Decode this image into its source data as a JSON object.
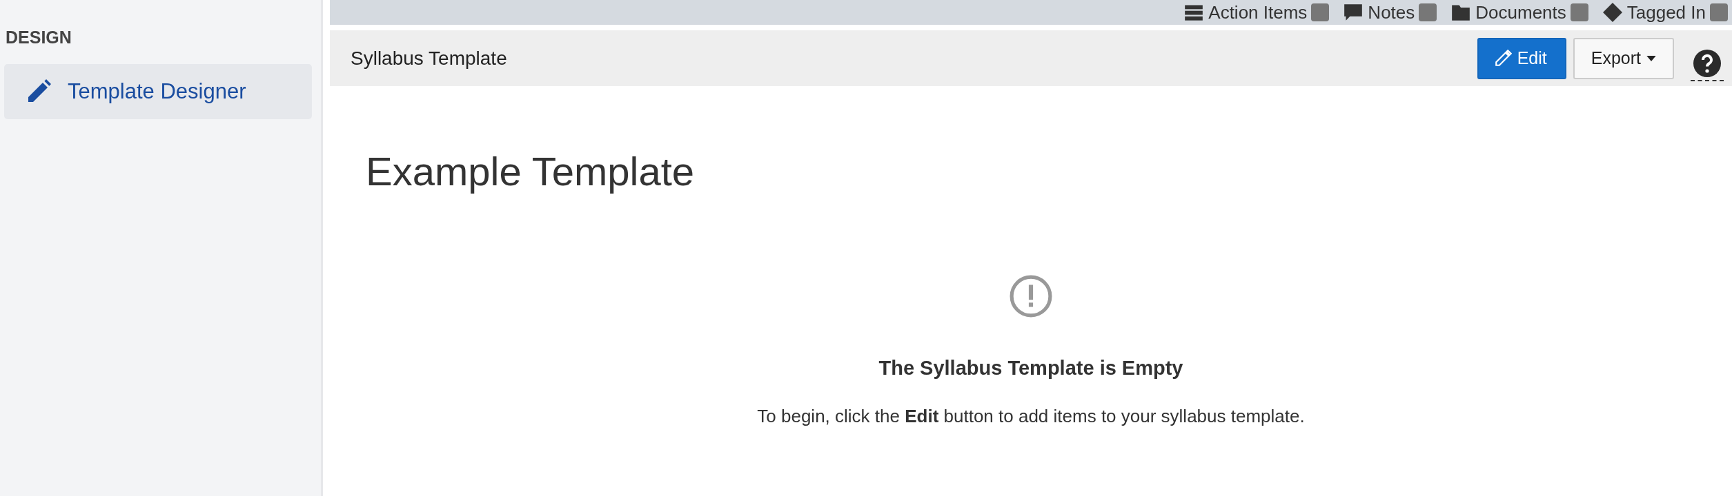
{
  "sidebar": {
    "heading": "DESIGN",
    "items": [
      {
        "label": "Template Designer",
        "selected": true
      }
    ]
  },
  "top_bar": {
    "items": [
      {
        "kind": "list",
        "label": "Action Items"
      },
      {
        "kind": "note",
        "label": "Notes"
      },
      {
        "kind": "folder",
        "label": "Documents"
      },
      {
        "kind": "tag",
        "label": "Tagged In"
      }
    ]
  },
  "header": {
    "title": "Syllabus Template",
    "buttons": [
      {
        "kind": "edit",
        "label": "Edit"
      },
      {
        "kind": "dropdown",
        "label": "Export"
      }
    ]
  },
  "page": {
    "title": "Example Template",
    "empty_state": {
      "heading": "The Syllabus Template is Empty",
      "message": "To begin, click the **Edit** button to add items to your syllabus template."
    }
  }
}
